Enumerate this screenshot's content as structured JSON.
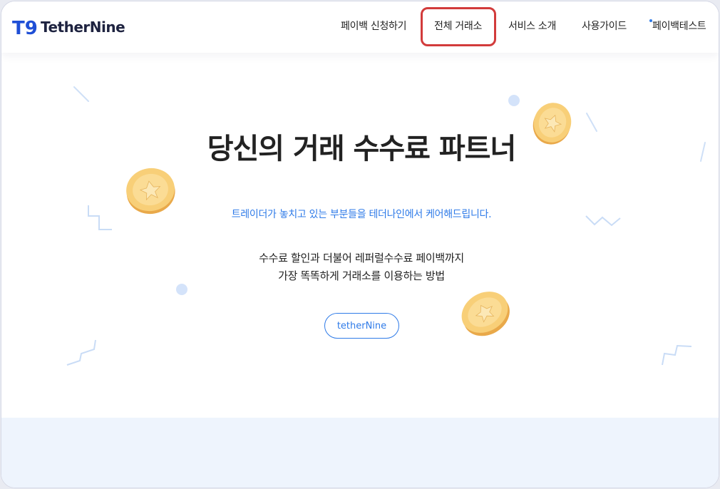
{
  "brand": {
    "logo_mark": "T9",
    "logo_text": "TetherNine"
  },
  "nav": {
    "items": [
      {
        "label": "페이백 신청하기"
      },
      {
        "label": "전체 거래소",
        "highlighted": true
      },
      {
        "label": "서비스 소개"
      },
      {
        "label": "사용가이드"
      },
      {
        "label": "페이백테스트"
      }
    ]
  },
  "hero": {
    "title": "당신의 거래 수수료 파트너",
    "subtitle": "트레이더가 놓치고 있는 부분들을 테더나인에서 케어해드립니다.",
    "description_line1": "수수료 할인과 더불어 레퍼럴수수료 페이백까지",
    "description_line2": "가장 똑똑하게 거래소를 이용하는 방법",
    "cta_label": "tetherNine"
  },
  "colors": {
    "accent": "#2f7be8",
    "highlight_border": "#d23b3b",
    "coin": "#f7c96b",
    "band": "#eef4fd"
  },
  "icons": [
    "coin-icon",
    "star-icon",
    "zigzag-decoration",
    "dot-decoration"
  ]
}
